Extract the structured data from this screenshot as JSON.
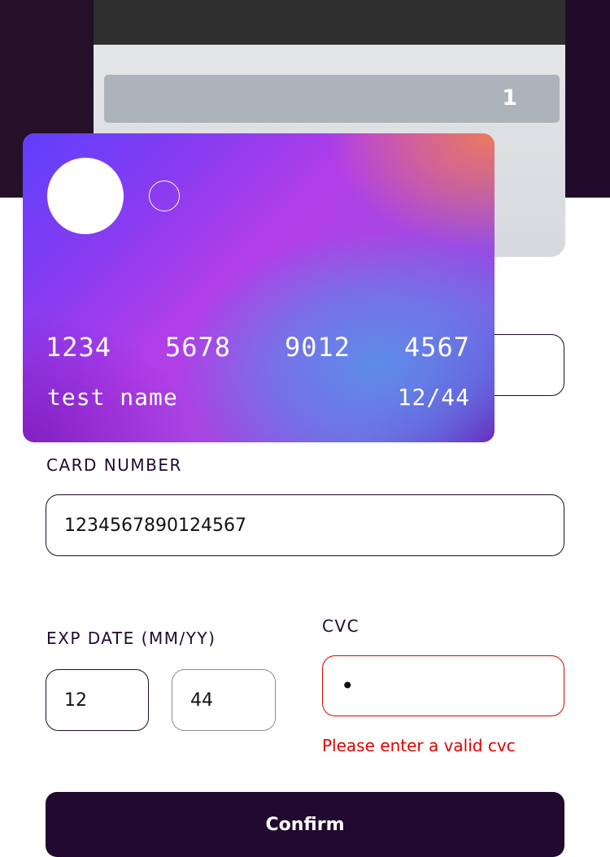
{
  "card_back": {
    "cvc": "1"
  },
  "card_front": {
    "number_groups": [
      "1234",
      "5678",
      "9012",
      "4567"
    ],
    "holder_name": "test name",
    "expiry": "12/44"
  },
  "form": {
    "card_number_label": "CARD NUMBER",
    "card_number_value": "1234567890124567",
    "exp_label": "EXP DATE (MM/YY)",
    "exp_month_value": "12",
    "exp_year_value": "44",
    "cvc_label": "CVC",
    "cvc_value": "•",
    "cvc_error": "Please enter a valid cvc",
    "confirm_label": "Confirm"
  },
  "colors": {
    "header_bg": "#21092f",
    "error": "#e00000",
    "button_bg": "#21092f"
  }
}
